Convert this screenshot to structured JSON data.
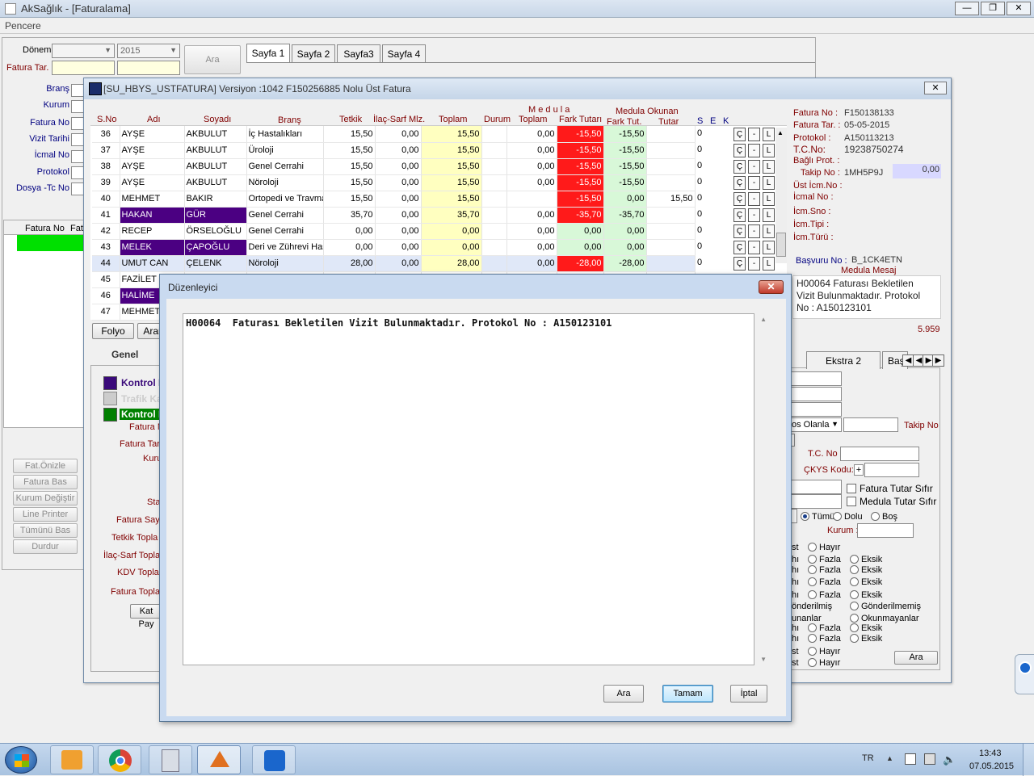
{
  "app": {
    "title": "AkSağlık - [Faturalama]",
    "menu": "Pencere"
  },
  "left": {
    "donem_label": "Dönem",
    "year": "2015",
    "fatura_tar_label": "Fatura Tar.",
    "ara": "Ara",
    "filters": [
      "Branş",
      "Kurum",
      "Fatura No",
      "Vizit Tarihi",
      "İcmal No",
      "Protokol",
      "Dosya -Tc No"
    ],
    "grid_headers": [
      "Fatura No",
      "Fatu"
    ],
    "buttons": [
      "Fat.Önizle",
      "Fatura Bas",
      "Kurum Değiştir",
      "Line Printer",
      "Tümünü Bas",
      "Durdur"
    ]
  },
  "tabs": [
    "Sayfa 1",
    "Sayfa 2",
    "Sayfa3",
    "Sayfa 4"
  ],
  "inner": {
    "title": "[SU_HBYS_USTFATURA] Versiyon :1042 F150256885 Nolu Üst Fatura",
    "headers": {
      "sno": "S.No",
      "adi": "Adı",
      "soyadi": "Soyadı",
      "brans": "Branş",
      "tetkik": "Tetkik",
      "ilac": "İlaç-Sarf Mlz.",
      "toplam": "Toplam",
      "durum": "Durum",
      "medula": "M e d u l a",
      "medula_toplam": "Toplam",
      "fark": "Fark Tutarı",
      "okunan": "Medula Okunan",
      "fark_tut": "Fark Tut.",
      "tutar": "Tutar",
      "s": "S",
      "e": "E",
      "k": "K"
    },
    "rows": [
      {
        "no": "36",
        "ad": "AYŞE",
        "soyad": "AKBULUT",
        "brans": "İç Hastalıkları",
        "tetkik": "15,50",
        "ilac": "0,00",
        "toplam": "15,50",
        "mtoplam": "0,00",
        "fark": "-15,50",
        "ftut": "-15,50",
        "tutar": "",
        "s": "0"
      },
      {
        "no": "37",
        "ad": "AYŞE",
        "soyad": "AKBULUT",
        "brans": "Üroloji",
        "tetkik": "15,50",
        "ilac": "0,00",
        "toplam": "15,50",
        "mtoplam": "0,00",
        "fark": "-15,50",
        "ftut": "-15,50",
        "tutar": "",
        "s": "0"
      },
      {
        "no": "38",
        "ad": "AYŞE",
        "soyad": "AKBULUT",
        "brans": "Genel Cerrahi",
        "tetkik": "15,50",
        "ilac": "0,00",
        "toplam": "15,50",
        "mtoplam": "0,00",
        "fark": "-15,50",
        "ftut": "-15,50",
        "tutar": "",
        "s": "0"
      },
      {
        "no": "39",
        "ad": "AYŞE",
        "soyad": "AKBULUT",
        "brans": "Nöroloji",
        "tetkik": "15,50",
        "ilac": "0,00",
        "toplam": "15,50",
        "mtoplam": "0,00",
        "fark": "-15,50",
        "ftut": "-15,50",
        "tutar": "",
        "s": "0"
      },
      {
        "no": "40",
        "ad": "MEHMET",
        "soyad": "BAKIR",
        "brans": "Ortopedi ve Travma",
        "tetkik": "15,50",
        "ilac": "0,00",
        "toplam": "15,50",
        "mtoplam": "",
        "fark": "-15,50",
        "ftut": "0,00",
        "tutar": "15,50",
        "s": "0"
      },
      {
        "no": "41",
        "ad": "HAKAN",
        "soyad": "GÜR",
        "brans": "Genel Cerrahi",
        "tetkik": "35,70",
        "ilac": "0,00",
        "toplam": "35,70",
        "mtoplam": "0,00",
        "fark": "-35,70",
        "ftut": "-35,70",
        "tutar": "",
        "s": "0"
      },
      {
        "no": "42",
        "ad": "RECEP",
        "soyad": "ÖRSELOĞLU",
        "brans": "Genel Cerrahi",
        "tetkik": "0,00",
        "ilac": "0,00",
        "toplam": "0,00",
        "mtoplam": "0,00",
        "fark": "0,00",
        "ftut": "0,00",
        "tutar": "",
        "s": "0"
      },
      {
        "no": "43",
        "ad": "MELEK",
        "soyad": "ÇAPOĞLU",
        "brans": "Deri ve Zührevi Has",
        "tetkik": "0,00",
        "ilac": "0,00",
        "toplam": "0,00",
        "mtoplam": "0,00",
        "fark": "0,00",
        "ftut": "0,00",
        "tutar": "",
        "s": "0"
      },
      {
        "no": "44",
        "ad": "UMUT CAN",
        "soyad": "ÇELENK",
        "brans": "Nöroloji",
        "tetkik": "28,00",
        "ilac": "0,00",
        "toplam": "28,00",
        "mtoplam": "0,00",
        "fark": "-28,00",
        "ftut": "-28,00",
        "tutar": "",
        "s": "0"
      },
      {
        "no": "45",
        "ad": "FAZİLET",
        "soyad": "",
        "brans": "",
        "tetkik": "",
        "ilac": "",
        "toplam": "",
        "mtoplam": "",
        "fark": "",
        "ftut": "",
        "tutar": "",
        "s": ""
      },
      {
        "no": "46",
        "ad": "HALİME",
        "soyad": "",
        "brans": "",
        "tetkik": "",
        "ilac": "",
        "toplam": "",
        "mtoplam": "",
        "fark": "",
        "ftut": "",
        "tutar": "",
        "s": ""
      },
      {
        "no": "47",
        "ad": "MEHMET",
        "soyad": "",
        "brans": "",
        "tetkik": "",
        "ilac": "",
        "toplam": "",
        "mtoplam": "",
        "fark": "",
        "ftut": "",
        "tutar": "",
        "s": ""
      }
    ],
    "row_buttons": [
      "Ç",
      "-",
      "L"
    ],
    "info": {
      "fatura_no_label": "Fatura No :",
      "fatura_no": "F150138133",
      "fatura_tar_label": "Fatura Tar. :",
      "fatura_tar": "05-05-2015",
      "protokol_label": "Protokol :",
      "protokol": "A150113213",
      "tc_label": "T.C.No:",
      "tc": "19238750274",
      "bagli_label": "Bağlı Prot. :",
      "takip_label": "Takip No :",
      "takip": "1MH5P9J",
      "takip_val": "0,00",
      "ust_icm": "Üst İcm.No :",
      "icmal": "İcmal No :",
      "icm_sno": "İcm.Sno :",
      "icm_tipi": "İcm.Tipi :",
      "icm_turu": "İcm.Türü :",
      "basvuru_label": "Başvuru No :",
      "basvuru": "B_1CK4ETN",
      "medula_mesaj": "Medula Mesaj",
      "mesaj": "H00064  Faturası Bekletilen Vizit Bulunmaktadır. Protokol No : A150123101",
      "count": "5.959"
    },
    "bottom_buttons": [
      "Folyo",
      "Aran"
    ],
    "genel_tab": "Genel",
    "kontrol1": "Kontrol E",
    "trafik": "Trafik Ka",
    "kontrol2": "Kontrol E",
    "form_labels": [
      "Fatura N",
      "Fatura Tar",
      "Kuru",
      "Sta",
      "Fatura  Say",
      "Tetkik Topla",
      "İlaç-Sarf Topla",
      "KDV Topla",
      "Fatura Topla"
    ],
    "kat_btn": "Kat Pay",
    "right_panel": {
      "tab_ekstra": "Ekstra 2",
      "tab_bas": "Baş",
      "dropdown": "os Olanla",
      "takip_no": "Takip No",
      "tc_no": "T.C. No",
      "ckys": "ÇKYS Kodu:",
      "plus": "+",
      "fatura_tutar": "Fatura Tutar Sıfır",
      "medula_tutar": "Medula Tutar Sıfır",
      "tumu": "Tümü",
      "dolu": "Dolu",
      "bos": "Boş",
      "kurum": "Kurum :",
      "hayir": "Hayır",
      "fazla": "Fazla",
      "eksik": "Eksik",
      "gonderilmis": "önderilmiş",
      "gonderilmemis": "Gönderilmemiş",
      "okunanlar": "unanlar",
      "okunmayanlar": "Okunmayanlar",
      "ara": "Ara",
      "st": "st",
      "hi": "hı"
    }
  },
  "dialog": {
    "title": "Düzenleyici",
    "text": "H00064  Faturası Bekletilen Vizit Bulunmaktadır. Protokol No : A150123101",
    "ara": "Ara",
    "tamam": "Tamam",
    "iptal": "İptal"
  },
  "taskbar": {
    "lang": "TR",
    "time": "13:43",
    "date": "07.05.2015"
  }
}
